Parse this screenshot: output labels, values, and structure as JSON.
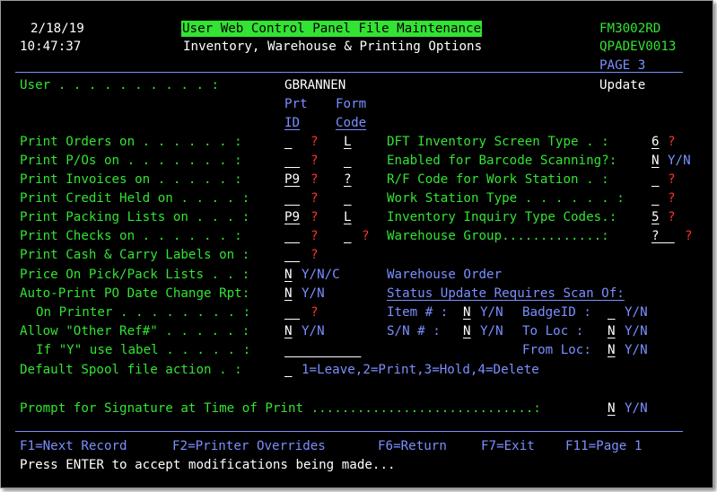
{
  "header": {
    "date": "2/18/19",
    "time": "10:47:37",
    "title": "User Web Control Panel File Maintenance",
    "subtitle": "Inventory, Warehouse & Printing Options",
    "program": "FM3002RD",
    "device": "QPADEV0013",
    "page": "PAGE 3",
    "mode": "Update"
  },
  "user": {
    "label": "User . . . . . . . . . . :",
    "value": "GBRANNEN"
  },
  "column_headers": {
    "prt": "Prt",
    "id": "ID",
    "form": "Form",
    "code": "Code"
  },
  "left_rows": [
    {
      "label": "Print Orders on . . . . . . :",
      "prt_id": "_",
      "form": "L"
    },
    {
      "label": "Print P/Os on . . . . . . . :",
      "prt_id": "__",
      "form": "_"
    },
    {
      "label": "Print Invoices on . . . . . :",
      "prt_id": "P9",
      "form": "?"
    },
    {
      "label": "Print Credit Held on . . . . :",
      "prt_id": "__",
      "form": "_"
    },
    {
      "label": "Print Packing Lists on . . . :",
      "prt_id": "P9",
      "form": "L"
    },
    {
      "label": "Print Checks on . . . . . . :",
      "prt_id": "__",
      "form": "_"
    },
    {
      "label": "Print Cash & Carry Labels on :",
      "prt_id": "__"
    }
  ],
  "right_rows": [
    {
      "label": "DFT Inventory Screen Type . :",
      "value": "6",
      "prompt": "?"
    },
    {
      "label": "Enabled for Barcode Scanning?:",
      "value": "N",
      "hint": "Y/N"
    },
    {
      "label": "R/F Code for Work Station . :",
      "value": "_",
      "prompt": "?"
    },
    {
      "label": "Work Station Type . . . . . . :",
      "value": "_",
      "prompt": "?"
    },
    {
      "label": "Inventory Inquiry Type Codes.:",
      "value": "5",
      "prompt": "?"
    },
    {
      "label": "Warehouse Group.............:",
      "value": "?__",
      "prompt": "?"
    }
  ],
  "prompt_marker": "?",
  "price_on_pick": {
    "label": "Price On Pick/Pack Lists . . :",
    "value": "N",
    "hint": "Y/N/C"
  },
  "auto_print_po": {
    "label": "Auto-Print PO Date Change Rpt:",
    "value": "N",
    "hint": "Y/N"
  },
  "on_printer": {
    "label": "On Printer . . . . . . . . :",
    "value": "__"
  },
  "allow_other_ref": {
    "label": "Allow \"Other Ref#\" . . . . . :",
    "value": "N",
    "hint": "Y/N"
  },
  "if_y_label": {
    "label": "If \"Y\" use label . . . . . :",
    "value": "__________"
  },
  "default_spool": {
    "label": "Default Spool file action . :",
    "value": "_",
    "hint": "1=Leave,2=Print,3=Hold,4=Delete"
  },
  "warehouse_order": {
    "heading": "Warehouse Order",
    "subheading": "Status Update Requires Scan Of:",
    "item_label": "Item # :",
    "item_value": "N",
    "item_hint": "Y/N",
    "badge_label": "BadgeID :",
    "badge_value": "_",
    "badge_hint": "Y/N",
    "sn_label": "S/N # :",
    "sn_value": "N",
    "sn_hint": "Y/N",
    "toloc_label": "To Loc :",
    "toloc_value": "N",
    "toloc_hint": "Y/N",
    "fromloc_label": "From Loc:",
    "fromloc_value": "N",
    "fromloc_hint": "Y/N"
  },
  "signature_prompt": {
    "label": "Prompt for Signature at Time of Print .............................:",
    "value": "N",
    "hint": "Y/N"
  },
  "function_keys": [
    "F1=Next Record",
    "F2=Printer Overrides",
    "F6=Return",
    "F7=Exit",
    "F11=Page 1"
  ],
  "message": "Press ENTER to accept modifications being made...",
  "colors": {
    "background": "#000000",
    "green": "#33e333",
    "blue": "#7b8fff",
    "white": "#ffffff",
    "red": "#ff3030"
  }
}
